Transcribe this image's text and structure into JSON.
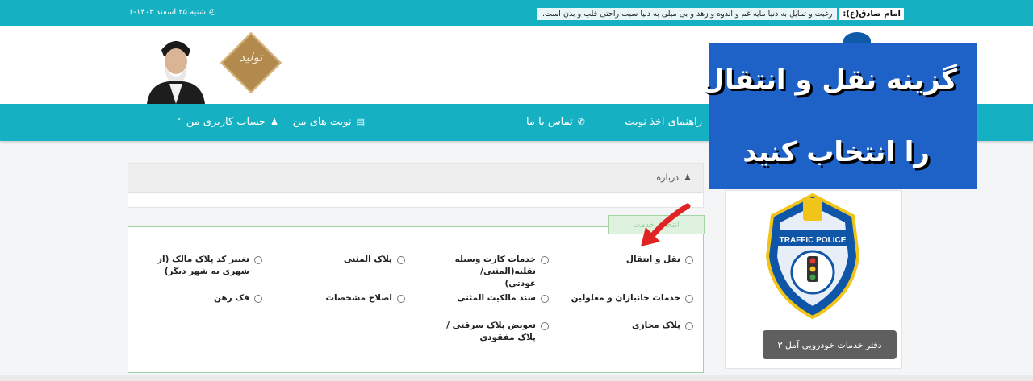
{
  "topbar": {
    "quote_title": "امام صادق(ع):",
    "quote_text": "رغبت و تمایل به دنیا مایه غم و اندوه و زهد و بی میلی به دنیا سبب راحتی قلب و بدن است.",
    "date": "شنبه ۲۵ اسفند ۱۴۰۳-۶",
    "clock_icon": "clock-icon"
  },
  "header": {
    "emblem_text": "تولید"
  },
  "nav": {
    "guide": "راهنمای اخذ نوبت",
    "contact": "تماس با ما",
    "appointments": "نوبت های من",
    "account": "حساب کاربری من"
  },
  "about_panel": {
    "title": "درباره"
  },
  "services": {
    "select_button": "انتخاب خدمت",
    "options": [
      "نقل و انتقال",
      "خدمات کارت وسیله نقلیه(المثنی/عودتی)",
      "پلاک المثنی",
      "تغییر کد پلاک مالک (از شهری به شهر دیگر)",
      "خدمات جانبازان و معلولین",
      "سند مالکیت المثنی",
      "اصلاح مشخصات",
      "فک رهن",
      "پلاک مجازی",
      "تعویض پلاک سرقتی / پلاک مفقودی"
    ]
  },
  "sidebar": {
    "badge_text": "TRAFFIC POLICE",
    "office_label": "دفتر خدمات خودرویی آمل ۳"
  },
  "callout": {
    "line1": "گزینه نقل و انتقال",
    "line2": "را انتخاب کنید",
    "color": "#1f62c7"
  },
  "colors": {
    "primary": "#15b0c2",
    "arrow": "#e02424"
  }
}
